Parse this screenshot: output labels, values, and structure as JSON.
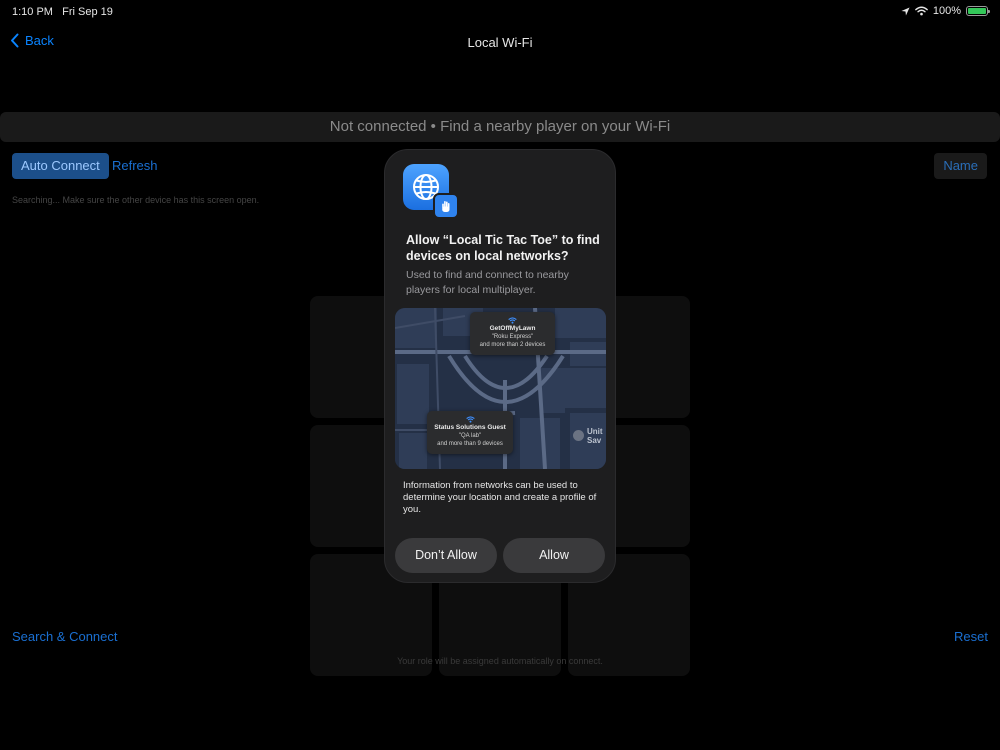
{
  "status_bar": {
    "time": "1:10 PM",
    "date": "Fri Sep 19",
    "battery": "100%",
    "icons": [
      "location-icon",
      "wifi-icon",
      "battery-icon"
    ]
  },
  "navbar": {
    "back_label": "Back",
    "title": "Local Wi-Fi"
  },
  "banner": {
    "text": "Not connected • Find a nearby player on your Wi-Fi"
  },
  "controls": {
    "auto_connect": "Auto Connect",
    "refresh": "Refresh",
    "name": "Name"
  },
  "searching_text": "Searching... Make sure the other device has this screen open.",
  "board": {
    "cells": [
      "",
      "",
      "",
      "",
      "",
      "",
      "",
      "",
      ""
    ]
  },
  "footer": {
    "search_connect": "Search & Connect",
    "reset": "Reset",
    "role_note": "Your role will be assigned automatically on connect."
  },
  "alert": {
    "title": "Allow “Local Tic Tac Toe” to find devices on local networks?",
    "message": "Used to find and connect to nearby players for local multiplayer.",
    "map": {
      "networks": [
        {
          "name": "GetOffMyLawn",
          "device": "\"Roku Express\"",
          "more": "and more than 2 devices"
        },
        {
          "name": "Status Solutions Guest",
          "device": "\"QA lab\"",
          "more": "and more than 9 devices"
        }
      ],
      "poi": [
        "Unit",
        "Sav"
      ]
    },
    "info": "Information from networks can be used to determine your location and create a profile of you.",
    "deny_label": "Don’t Allow",
    "allow_label": "Allow"
  },
  "colors": {
    "accent": "#0a84ff",
    "background": "#000000",
    "alert_bg": "#1e1e1f",
    "battery": "#34c759"
  }
}
